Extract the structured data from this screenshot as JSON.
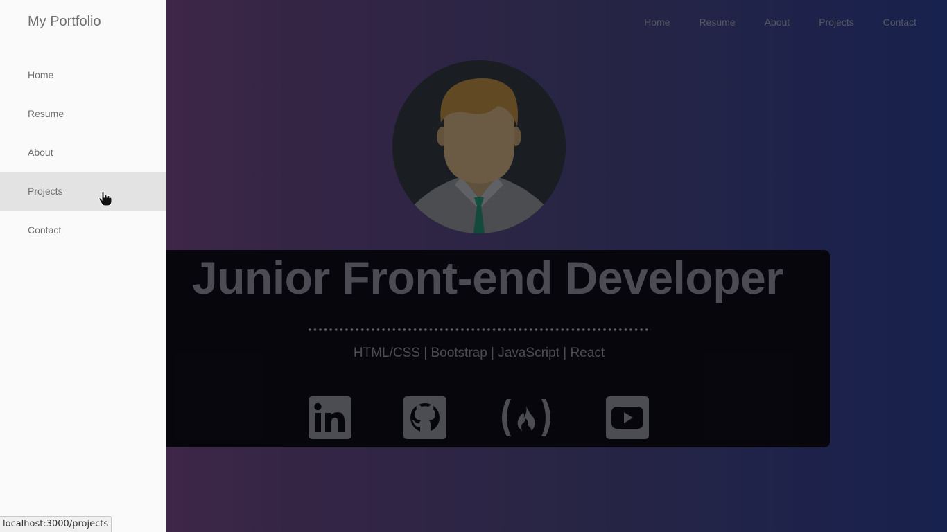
{
  "drawer": {
    "title": "My Portfolio",
    "items": [
      {
        "label": "Home"
      },
      {
        "label": "Resume"
      },
      {
        "label": "About"
      },
      {
        "label": "Projects",
        "active": true
      },
      {
        "label": "Contact"
      }
    ]
  },
  "topnav": {
    "items": [
      {
        "label": "Home"
      },
      {
        "label": "Resume"
      },
      {
        "label": "About"
      },
      {
        "label": "Projects"
      },
      {
        "label": "Contact"
      }
    ]
  },
  "hero": {
    "title": "Junior Front-end Developer",
    "skills": "HTML/CSS | Bootstrap | JavaScript | React",
    "social_icons": [
      "linkedin-icon",
      "github-icon",
      "freecodecamp-icon",
      "youtube-icon"
    ]
  },
  "statusbar": {
    "url": "localhost:3000/projects"
  },
  "colors": {
    "drawer_bg": "#fafafa",
    "drawer_active": "#e3e3e3",
    "hero_card": "#0b0a12",
    "gradient_start": "#6b3a6b",
    "gradient_end": "#233170"
  }
}
